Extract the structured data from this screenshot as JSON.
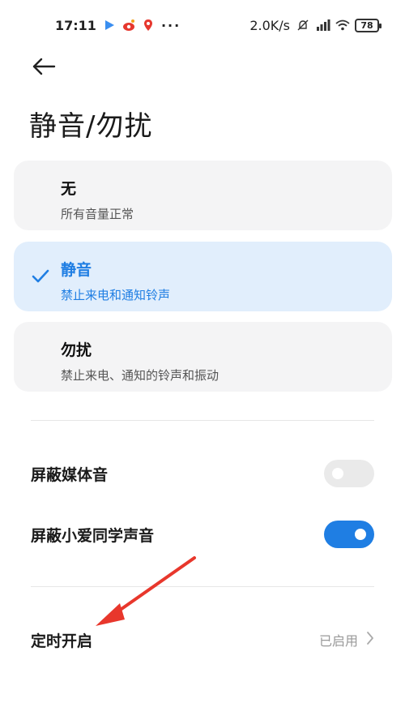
{
  "status_bar": {
    "time": "17:11",
    "network_speed": "2.0K/s",
    "battery": "78",
    "icons": [
      "play-icon",
      "weibo-icon",
      "location-pin-icon",
      "more-dots-icon",
      "silent-bell-icon",
      "signal-icon",
      "wifi-icon",
      "battery-icon"
    ]
  },
  "header": {
    "back_icon": "back-arrow-icon",
    "title": "静音/勿扰"
  },
  "modes": [
    {
      "title": "无",
      "subtitle": "所有音量正常",
      "selected": false
    },
    {
      "title": "静音",
      "subtitle": "禁止来电和通知铃声",
      "selected": true
    },
    {
      "title": "勿扰",
      "subtitle": "禁止来电、通知的铃声和振动",
      "selected": false
    }
  ],
  "toggles": {
    "mute_media": {
      "label": "屏蔽媒体音",
      "on": false
    },
    "mute_xiaoai": {
      "label": "屏蔽小爱同学声音",
      "on": true
    }
  },
  "schedule": {
    "label": "定时开启",
    "status": "已启用"
  },
  "colors": {
    "accent": "#1f7ee3",
    "selected_bg": "#e1eefc",
    "card_bg": "#f4f4f5",
    "annotation_arrow": "#e8372c"
  }
}
